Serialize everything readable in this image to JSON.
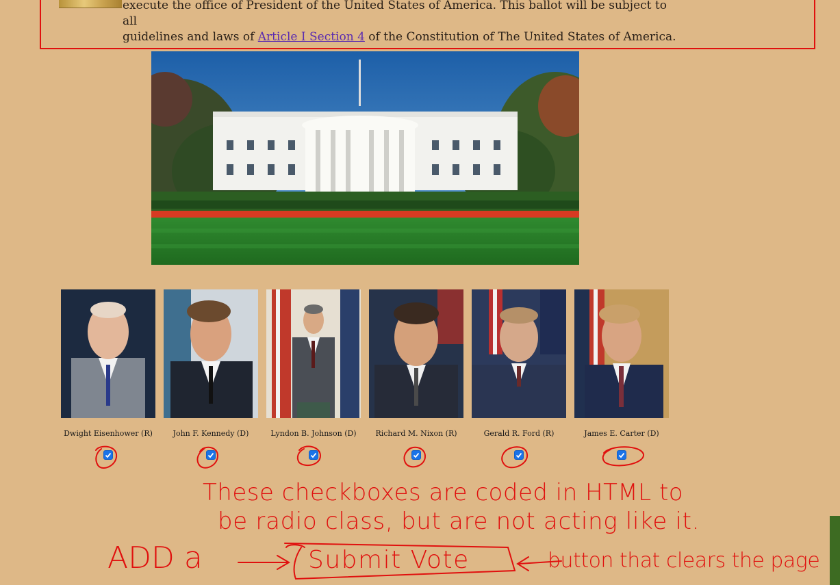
{
  "ballot": {
    "intro_line1": "execute the office of President of the United States of America. This ballot will be subject to all",
    "intro_line2_pre": "guidelines and laws of ",
    "intro_link": "Article I Section 4",
    "intro_line2_post": " of the Constitution of The United States of America."
  },
  "candidates": [
    {
      "name": "Dwight Eisenhower (R)",
      "checked": true
    },
    {
      "name": "John F. Kennedy (D)",
      "checked": true
    },
    {
      "name": "Lyndon B. Johnson (D)",
      "checked": true
    },
    {
      "name": "Richard M. Nixon (R)",
      "checked": true
    },
    {
      "name": "Gerald R. Ford (R)",
      "checked": true
    },
    {
      "name": "James E. Carter (D)",
      "checked": true
    }
  ],
  "annotation": {
    "line1": "These checkboxes are coded in HTML to",
    "line2": "be radio class, but are not acting like it.",
    "add": "ADD a",
    "submit": "Submit Vote",
    "after": "button that clears the page",
    "color": "#e0100e"
  },
  "colors": {
    "background": "#deb887",
    "border": "#e0100e",
    "link": "#5a2bb0",
    "checkbox": "#1a73e8"
  }
}
